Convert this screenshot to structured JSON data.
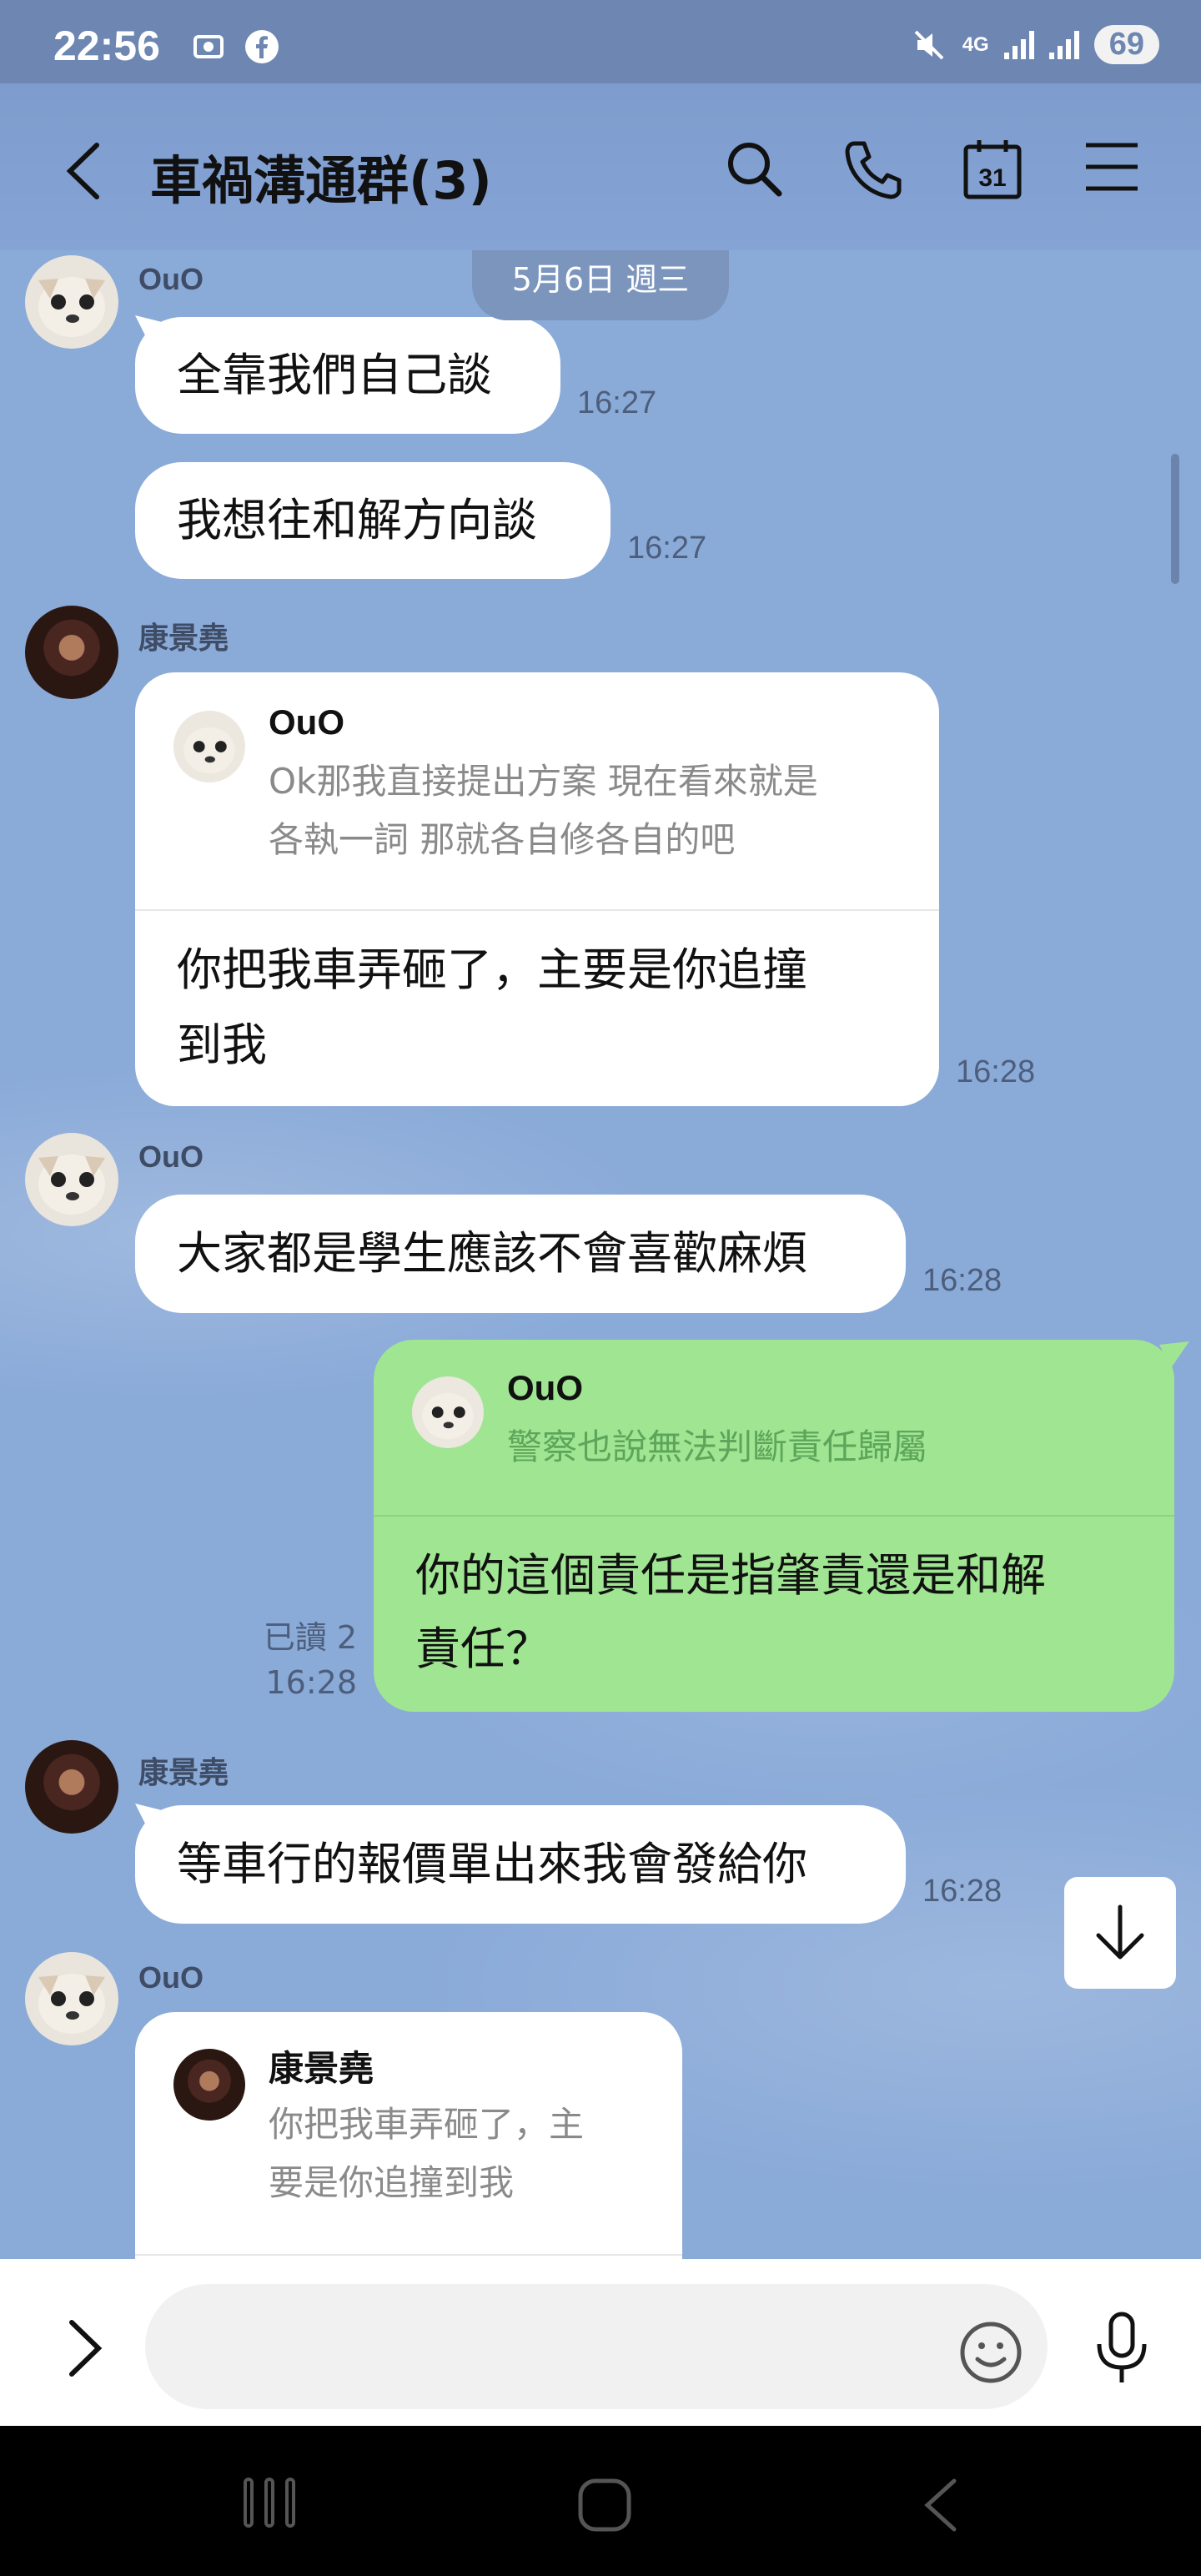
{
  "status_bar": {
    "time": "22:56",
    "network": "4G",
    "battery": "69"
  },
  "header": {
    "title": "車禍溝通群(3)"
  },
  "chat": {
    "date_divider": "5月6日 週三",
    "messages": [
      {
        "sender": "OuO",
        "text": "全靠我們自己談",
        "time": "16:27"
      },
      {
        "text": "我想往和解方向談",
        "time": "16:27"
      },
      {
        "sender": "康景堯",
        "quote_name": "OuO",
        "quote_line1": "Ok那我直接提出方案 現在看來就是",
        "quote_line2": "各執一詞 那就各自修各自的吧",
        "body_line1": "你把我車弄砸了，主要是你追撞",
        "body_line2": "到我",
        "time": "16:28"
      },
      {
        "sender": "OuO",
        "text": "大家都是學生應該不會喜歡麻煩",
        "time": "16:28"
      },
      {
        "outgoing": true,
        "quote_name": "OuO",
        "quote_line1": "警察也說無法判斷責任歸屬",
        "body_line1": "你的這個責任是指肇責還是和解",
        "body_line2": "責任？",
        "read_status": "已讀 2",
        "time": "16:28"
      },
      {
        "sender": "康景堯",
        "text": "等車行的報價單出來我會發給你",
        "time": "16:28"
      },
      {
        "sender": "OuO",
        "quote_name": "康景堯",
        "quote_line1": "你把我車弄砸了，主",
        "quote_line2": "要是你追撞到我"
      }
    ]
  },
  "input": {
    "placeholder": ""
  },
  "colors": {
    "chat_background": "#8aaad8",
    "outgoing_bubble": "#9fe592",
    "incoming_bubble": "#ffffff"
  }
}
